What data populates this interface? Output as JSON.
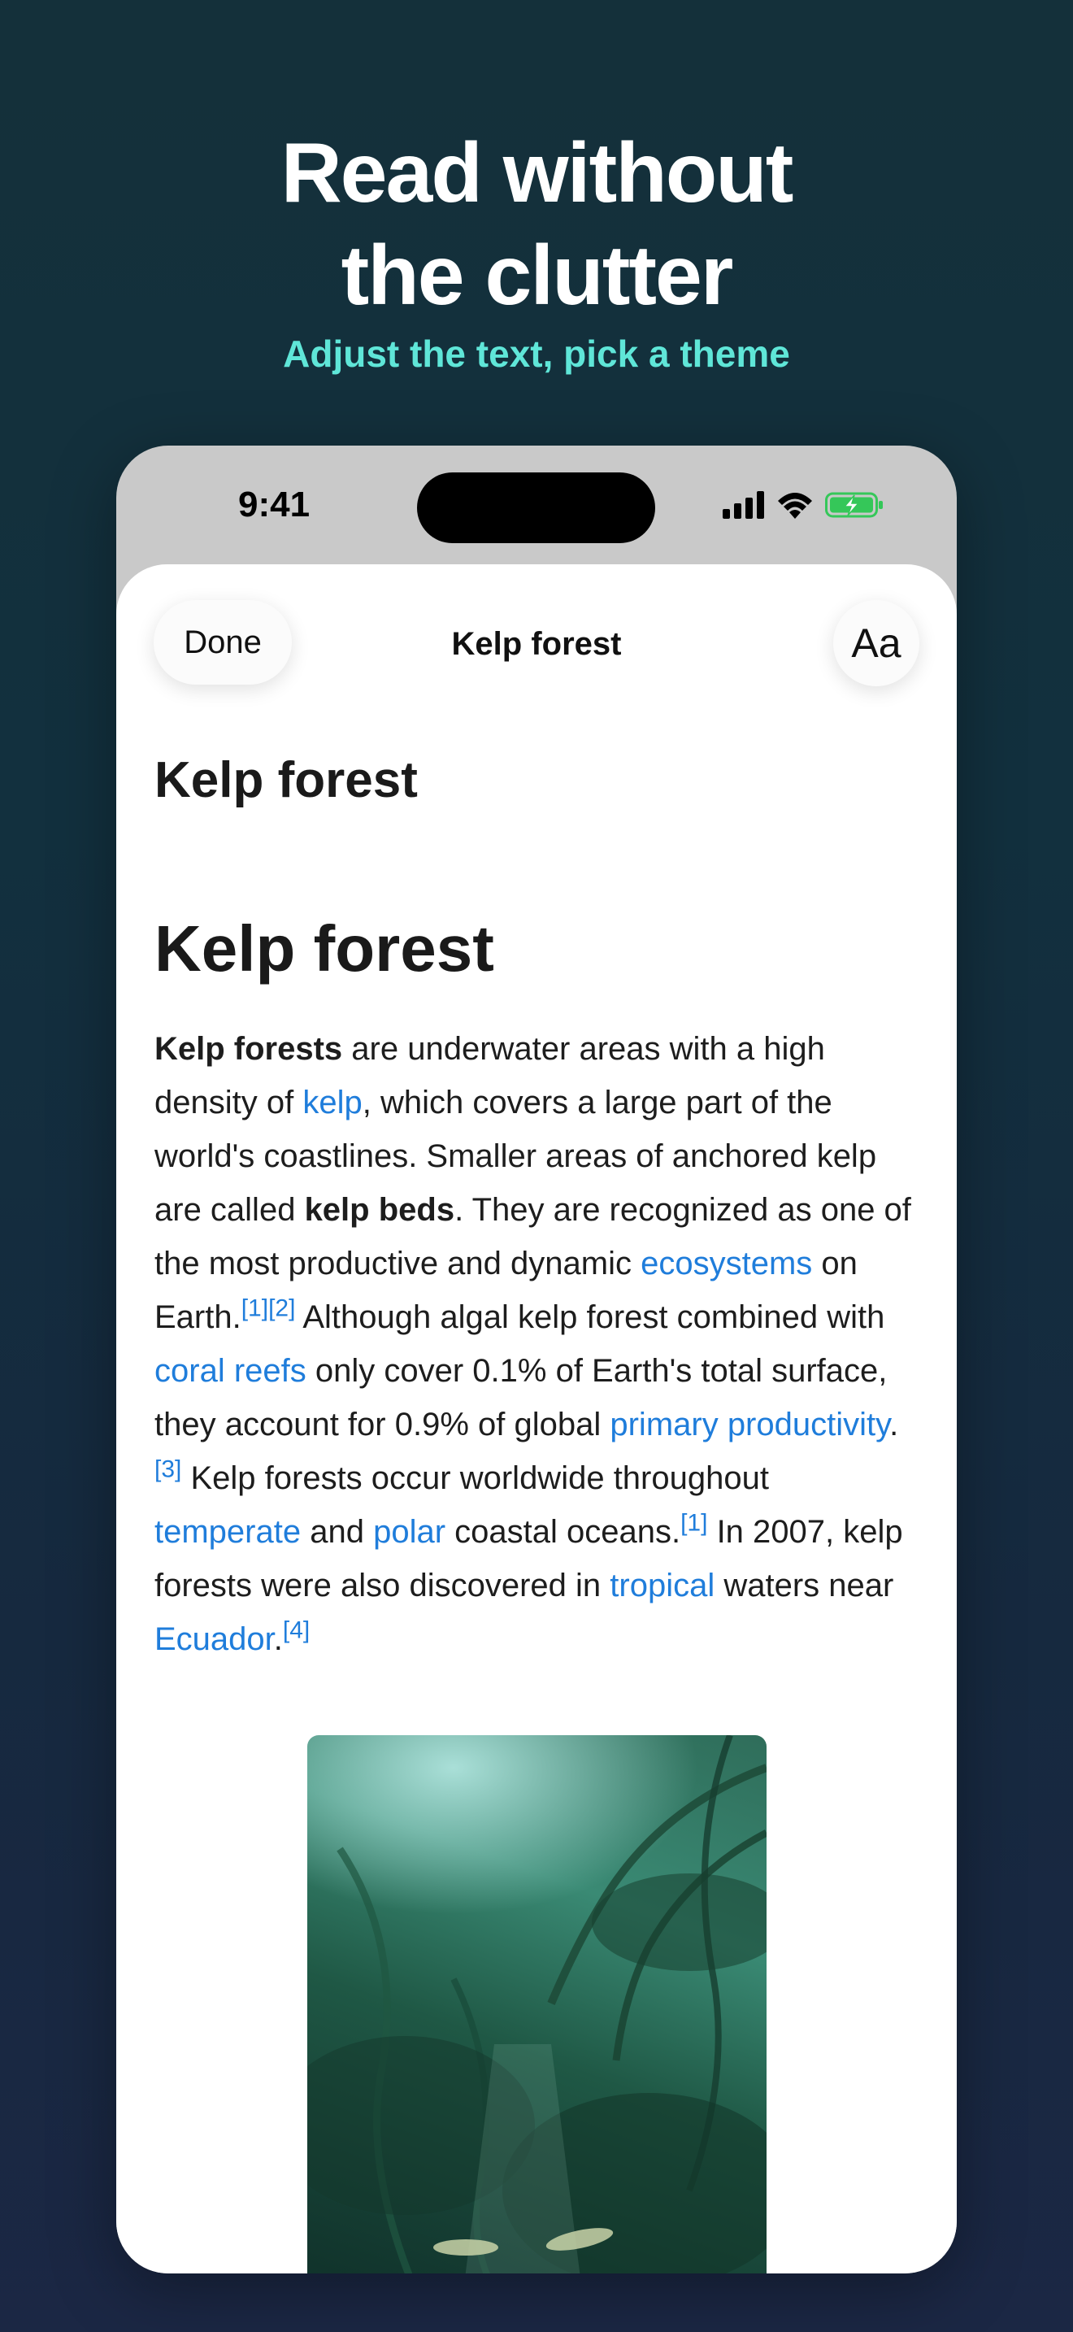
{
  "hero": {
    "title_line1": "Read without",
    "title_line2": "the clutter",
    "subtitle": "Adjust the text, pick a theme"
  },
  "status_bar": {
    "time": "9:41",
    "icons": [
      "cellular-signal-icon",
      "wifi-icon",
      "battery-charging-icon"
    ]
  },
  "nav": {
    "done_label": "Done",
    "title": "Kelp forest",
    "text_size_label": "Aa"
  },
  "article": {
    "page_title": "Kelp forest",
    "heading": "Kelp forest",
    "p": {
      "t1": "Kelp forests",
      "t2": " are underwater areas with a high density of ",
      "t3": "kelp",
      "t4": ", which covers a large part of the world's coastlines. Smaller areas of anchored kelp are called ",
      "t5": "kelp beds",
      "t6": ". They are recognized as one of the most productive and dynamic ",
      "t7": "ecosystems",
      "t8": " on Earth.",
      "t9": "[1]",
      "t10": "[2]",
      "t11": " Although algal kelp forest combined with ",
      "t12": "coral reefs",
      "t13": " only cover 0.1% of Earth's total surface, they account for 0.9% of global ",
      "t14": "primary productivity",
      "t15": ".",
      "t16": "[3]",
      "t17": " Kelp forests occur worldwide throughout ",
      "t18": "temperate",
      "t19": " and ",
      "t20": "polar",
      "t21": " coastal oceans.",
      "t22": "[1]",
      "t23": " In 2007, kelp forests were also discovered in ",
      "t24": "tropical",
      "t25": " waters near ",
      "t26": "Ecuador",
      "t27": ".",
      "t28": "[4]"
    }
  },
  "colors": {
    "background": "#14303a",
    "accent_subtitle": "#5fe6d8",
    "link": "#1f7ddb",
    "battery": "#35c759"
  }
}
